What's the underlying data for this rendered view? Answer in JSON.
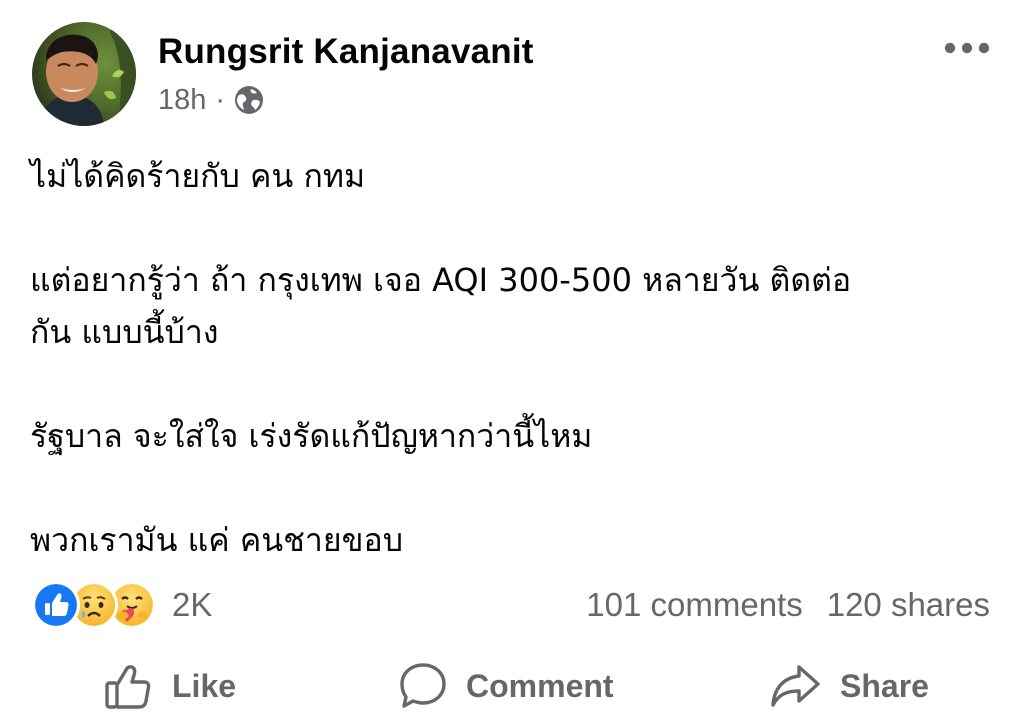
{
  "post": {
    "author": "Rungsrit Kanjanavanit",
    "time": "18h",
    "separator": "·",
    "privacy_icon": "globe-icon",
    "more_icon": "more-options-icon",
    "paragraphs": [
      {
        "lines": [
          "ไม่ได้คิดร้ายกับ คน กทม"
        ]
      },
      {
        "lines": [
          "แต่อยากรู้ว่า ถ้า กรุงเทพ เจอ AQI 300-500 หลายวัน ติดต่อ",
          "กัน แบบนี้บ้าง"
        ]
      },
      {
        "lines": [
          "รัฐบาล จะใส่ใจ เร่งรัดแก้ปัญหากว่านี้ไหม"
        ]
      },
      {
        "lines": [
          "พวกเรามัน แค่ คนชายขอบ"
        ]
      }
    ]
  },
  "reactions": {
    "icons": [
      "like-reaction-icon",
      "sad-reaction-icon",
      "care-reaction-icon"
    ],
    "count": "2K"
  },
  "stats": {
    "comments": "101 comments",
    "shares": "120 shares"
  },
  "actions": {
    "like": "Like",
    "comment": "Comment",
    "share": "Share"
  },
  "colors": {
    "text": "#050505",
    "secondary": "#65676b",
    "like_blue": "#1877f2"
  }
}
